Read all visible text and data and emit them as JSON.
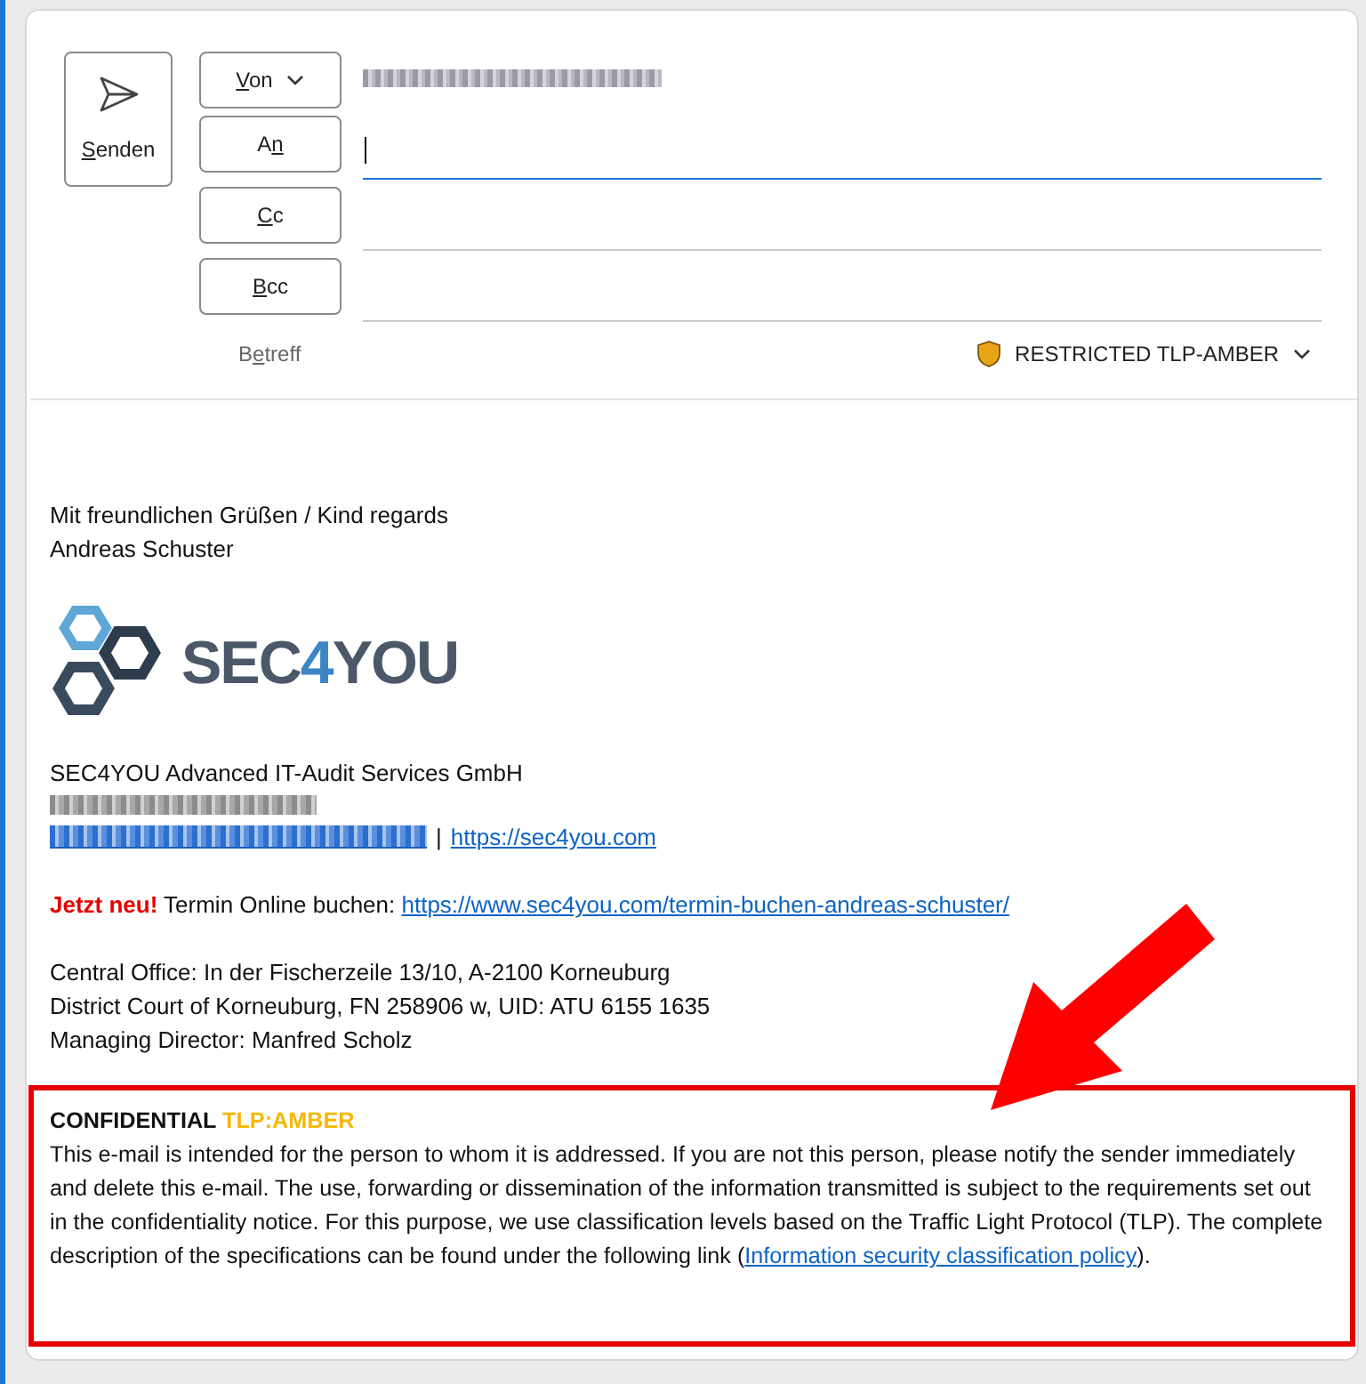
{
  "compose": {
    "send_button": {
      "key": "S",
      "post": "enden"
    },
    "from_button": {
      "key": "V",
      "post": "on"
    },
    "recipient_fields": [
      {
        "button": {
          "pre": "A",
          "key": "n"
        },
        "focused": true
      },
      {
        "button": {
          "key": "C",
          "post": "c"
        },
        "focused": false
      },
      {
        "button": {
          "key": "B",
          "post": "cc"
        },
        "focused": false
      }
    ],
    "subject_label": {
      "pre": "B",
      "key": "e",
      "post": "treff"
    },
    "sensitivity": {
      "label": "RESTRICTED TLP-AMBER",
      "color": "#e8a317"
    }
  },
  "body": {
    "greeting": "Mit freundlichen Grüßen / Kind regards",
    "name": "Andreas Schuster",
    "logo": {
      "pre": "SEC",
      "accent": "4",
      "post": "YOU"
    },
    "company": "SEC4YOU Advanced IT-Audit Services GmbH",
    "website_separator": "|",
    "website_link": "https://sec4you.com",
    "booking": {
      "highlight": "Jetzt neu!",
      "text": "Termin Online buchen:",
      "link": "https://www.sec4you.com/termin-buchen-andreas-schuster/"
    },
    "address_lines": [
      "Central Office: In der Fischerzeile 13/10, A-2100 Korneuburg",
      "District Court of Korneuburg, FN 258906 w, UID: ATU 6155 1635",
      "Managing Director: Manfred Scholz"
    ],
    "notice": {
      "title": "CONFIDENTIAL",
      "tag": "TLP:AMBER",
      "text": "This e-mail is intended for the person to whom it is addressed. If you are not this person, please notify the sender immediately and delete this e-mail. The use, forwarding or dissemination of the information transmitted is subject to the requirements set out in the confidentiality notice. For this purpose, we use classification levels based on the Traffic Light Protocol (TLP). The complete description of the specifications can be found under the following link (",
      "link": "Information security classification policy",
      "text_end": ")."
    }
  }
}
